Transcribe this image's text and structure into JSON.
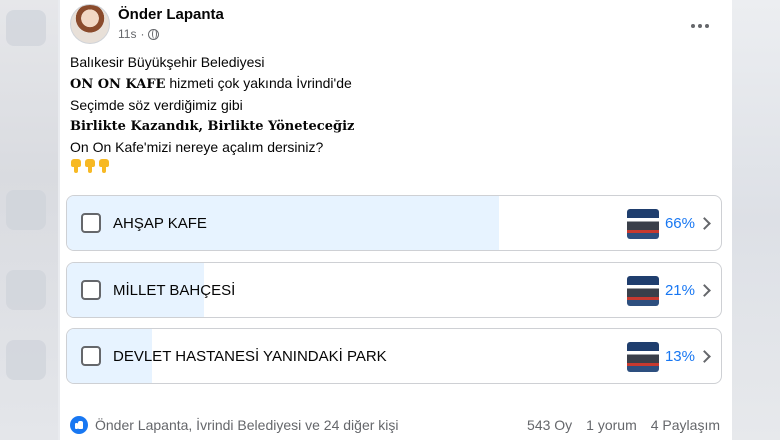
{
  "post": {
    "author": "Önder Lapanta",
    "time": "11s",
    "text_lines": [
      "Balıkesir Büyükşehir Belediyesi",
      "hizmeti çok yakında İvrindi'de",
      "Seçimde söz verdiğimiz gibi",
      "Birlikte Kazandık, Birlikte Yöneteceğiz",
      "On On Kafe'mizi nereye açalım dersiniz?"
    ],
    "bold_prefix": "ON ON KAFE",
    "emoji": "point-down-icon x3"
  },
  "poll": {
    "options": [
      {
        "label": "AHŞAP KAFE",
        "percent": "66%",
        "fill_fraction": 0.66
      },
      {
        "label": "MİLLET BAHÇESİ",
        "percent": "21%",
        "fill_fraction": 0.21
      },
      {
        "label": "DEVLET HASTANESİ YANINDAKİ PARK",
        "percent": "13%",
        "fill_fraction": 0.13
      }
    ]
  },
  "footer": {
    "reactions": "Önder Lapanta, İvrindi Belediyesi ve 24 diğer kişi",
    "votes": "543 Oy",
    "comments": "1 yorum",
    "shares": "4 Paylaşım"
  },
  "colors": {
    "accent": "#1877f2",
    "poll_fill": "#e7f3ff",
    "muted_text": "#65676b"
  }
}
